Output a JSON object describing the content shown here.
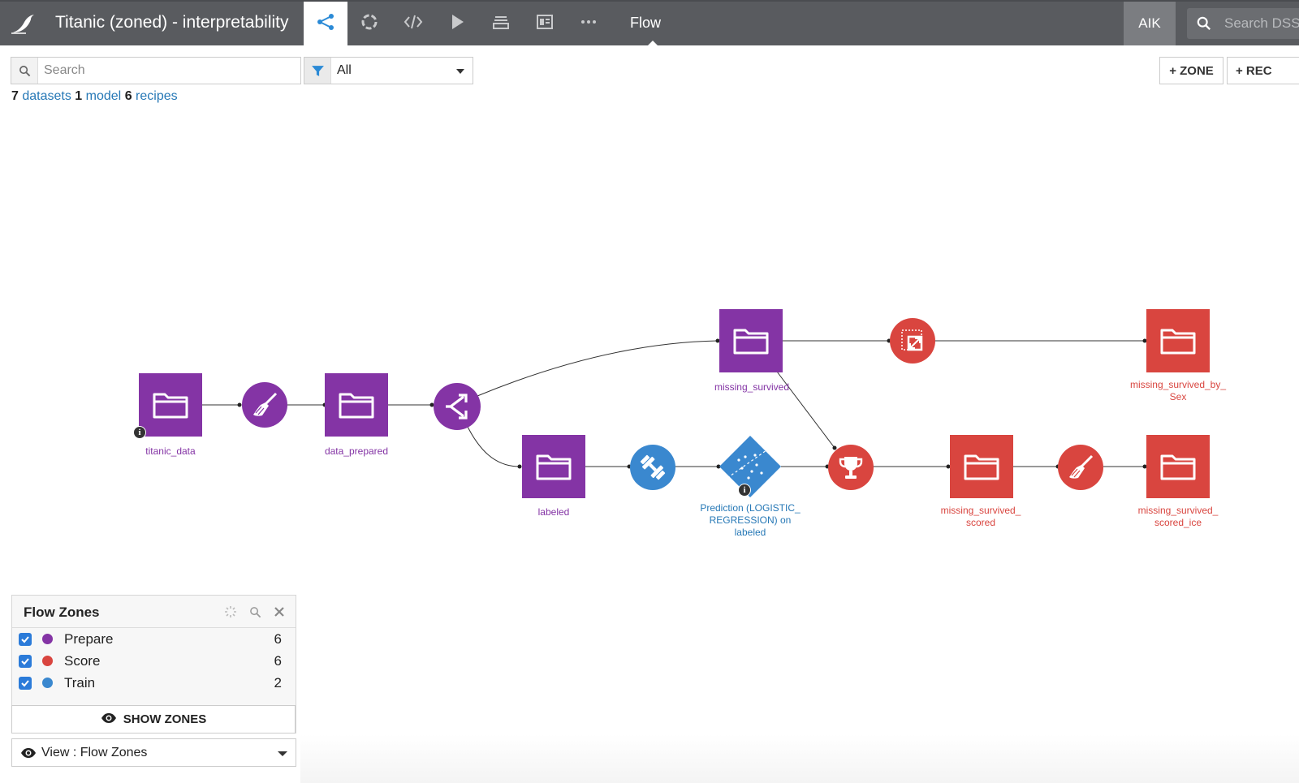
{
  "header": {
    "project_title": "Titanic (zoned) - interpretability",
    "nav_items": [
      {
        "name": "flow-icon",
        "active": true
      },
      {
        "name": "lab-icon"
      },
      {
        "name": "code-icon"
      },
      {
        "name": "run-icon"
      },
      {
        "name": "stack-icon"
      },
      {
        "name": "dashboard-icon"
      },
      {
        "name": "more-icon"
      }
    ],
    "section": "Flow",
    "user_initials": "AIK",
    "global_search_placeholder": "Search DSS"
  },
  "toolbar": {
    "search_placeholder": "Search",
    "filter_value": "All",
    "add_zone_label": "+ ZONE",
    "add_recipe_label": "+ REC"
  },
  "summary": {
    "datasets_count": "7",
    "datasets_label": "datasets",
    "models_count": "1",
    "models_label": "model",
    "recipes_count": "6",
    "recipes_label": "recipes"
  },
  "colors": {
    "prepare": "#8434a5",
    "score": "#d9453f",
    "train": "#3a88cf",
    "topbar": "#595b5f",
    "link": "#2678b6"
  },
  "flow": {
    "nodes": {
      "titanic_data": {
        "label": "titanic_data",
        "zone": "prepare",
        "kind": "dataset",
        "info": true
      },
      "prepare_recipe_1": {
        "zone": "prepare",
        "kind": "recipe",
        "icon": "broom-icon"
      },
      "data_prepared": {
        "label": "data_prepared",
        "zone": "prepare",
        "kind": "dataset"
      },
      "split_recipe": {
        "zone": "prepare",
        "kind": "recipe",
        "icon": "split-icon"
      },
      "missing_survived": {
        "label": "missing_survived",
        "zone": "prepare",
        "kind": "dataset"
      },
      "labeled": {
        "label": "labeled",
        "zone": "prepare",
        "kind": "dataset"
      },
      "train_recipe": {
        "zone": "train",
        "kind": "recipe",
        "icon": "dumbbell-icon"
      },
      "model": {
        "label_lines": [
          "Prediction (LOGISTIC_",
          "REGRESSION) on",
          "labeled"
        ],
        "zone": "train",
        "kind": "model",
        "info": true
      },
      "pivot_recipe": {
        "zone": "score",
        "kind": "recipe",
        "icon": "pivot-icon"
      },
      "missing_survived_by_sex": {
        "label_lines": [
          "missing_survived_by_",
          "Sex"
        ],
        "zone": "score",
        "kind": "dataset"
      },
      "score_recipe": {
        "zone": "score",
        "kind": "recipe",
        "icon": "trophy-icon"
      },
      "missing_survived_scored": {
        "label_lines": [
          "missing_survived_",
          "scored"
        ],
        "zone": "score",
        "kind": "dataset"
      },
      "prepare_recipe_2": {
        "zone": "score",
        "kind": "recipe",
        "icon": "broom-icon"
      },
      "missing_survived_scored_ice": {
        "label_lines": [
          "missing_survived_",
          "scored_ice"
        ],
        "zone": "score",
        "kind": "dataset"
      }
    }
  },
  "zones_panel": {
    "title": "Flow Zones",
    "zones": [
      {
        "name": "Prepare",
        "count": "6",
        "color": "#8434a5",
        "checked": true
      },
      {
        "name": "Score",
        "count": "6",
        "color": "#d9453f",
        "checked": true
      },
      {
        "name": "Train",
        "count": "2",
        "color": "#3a88cf",
        "checked": true
      }
    ],
    "show_zones_label": "SHOW ZONES",
    "view_label": "View : Flow Zones"
  }
}
